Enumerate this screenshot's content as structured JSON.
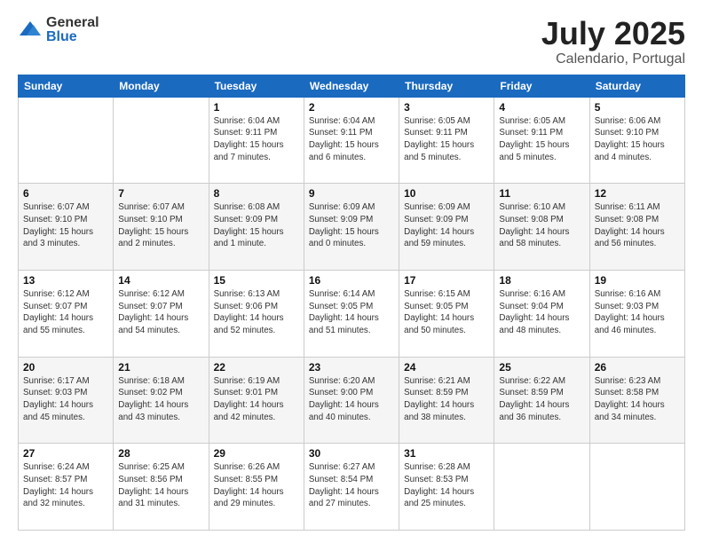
{
  "logo": {
    "general": "General",
    "blue": "Blue"
  },
  "title": "July 2025",
  "subtitle": "Calendario, Portugal",
  "header_days": [
    "Sunday",
    "Monday",
    "Tuesday",
    "Wednesday",
    "Thursday",
    "Friday",
    "Saturday"
  ],
  "weeks": [
    [
      {
        "day": "",
        "detail": ""
      },
      {
        "day": "",
        "detail": ""
      },
      {
        "day": "1",
        "detail": "Sunrise: 6:04 AM\nSunset: 9:11 PM\nDaylight: 15 hours\nand 7 minutes."
      },
      {
        "day": "2",
        "detail": "Sunrise: 6:04 AM\nSunset: 9:11 PM\nDaylight: 15 hours\nand 6 minutes."
      },
      {
        "day": "3",
        "detail": "Sunrise: 6:05 AM\nSunset: 9:11 PM\nDaylight: 15 hours\nand 5 minutes."
      },
      {
        "day": "4",
        "detail": "Sunrise: 6:05 AM\nSunset: 9:11 PM\nDaylight: 15 hours\nand 5 minutes."
      },
      {
        "day": "5",
        "detail": "Sunrise: 6:06 AM\nSunset: 9:10 PM\nDaylight: 15 hours\nand 4 minutes."
      }
    ],
    [
      {
        "day": "6",
        "detail": "Sunrise: 6:07 AM\nSunset: 9:10 PM\nDaylight: 15 hours\nand 3 minutes."
      },
      {
        "day": "7",
        "detail": "Sunrise: 6:07 AM\nSunset: 9:10 PM\nDaylight: 15 hours\nand 2 minutes."
      },
      {
        "day": "8",
        "detail": "Sunrise: 6:08 AM\nSunset: 9:09 PM\nDaylight: 15 hours\nand 1 minute."
      },
      {
        "day": "9",
        "detail": "Sunrise: 6:09 AM\nSunset: 9:09 PM\nDaylight: 15 hours\nand 0 minutes."
      },
      {
        "day": "10",
        "detail": "Sunrise: 6:09 AM\nSunset: 9:09 PM\nDaylight: 14 hours\nand 59 minutes."
      },
      {
        "day": "11",
        "detail": "Sunrise: 6:10 AM\nSunset: 9:08 PM\nDaylight: 14 hours\nand 58 minutes."
      },
      {
        "day": "12",
        "detail": "Sunrise: 6:11 AM\nSunset: 9:08 PM\nDaylight: 14 hours\nand 56 minutes."
      }
    ],
    [
      {
        "day": "13",
        "detail": "Sunrise: 6:12 AM\nSunset: 9:07 PM\nDaylight: 14 hours\nand 55 minutes."
      },
      {
        "day": "14",
        "detail": "Sunrise: 6:12 AM\nSunset: 9:07 PM\nDaylight: 14 hours\nand 54 minutes."
      },
      {
        "day": "15",
        "detail": "Sunrise: 6:13 AM\nSunset: 9:06 PM\nDaylight: 14 hours\nand 52 minutes."
      },
      {
        "day": "16",
        "detail": "Sunrise: 6:14 AM\nSunset: 9:05 PM\nDaylight: 14 hours\nand 51 minutes."
      },
      {
        "day": "17",
        "detail": "Sunrise: 6:15 AM\nSunset: 9:05 PM\nDaylight: 14 hours\nand 50 minutes."
      },
      {
        "day": "18",
        "detail": "Sunrise: 6:16 AM\nSunset: 9:04 PM\nDaylight: 14 hours\nand 48 minutes."
      },
      {
        "day": "19",
        "detail": "Sunrise: 6:16 AM\nSunset: 9:03 PM\nDaylight: 14 hours\nand 46 minutes."
      }
    ],
    [
      {
        "day": "20",
        "detail": "Sunrise: 6:17 AM\nSunset: 9:03 PM\nDaylight: 14 hours\nand 45 minutes."
      },
      {
        "day": "21",
        "detail": "Sunrise: 6:18 AM\nSunset: 9:02 PM\nDaylight: 14 hours\nand 43 minutes."
      },
      {
        "day": "22",
        "detail": "Sunrise: 6:19 AM\nSunset: 9:01 PM\nDaylight: 14 hours\nand 42 minutes."
      },
      {
        "day": "23",
        "detail": "Sunrise: 6:20 AM\nSunset: 9:00 PM\nDaylight: 14 hours\nand 40 minutes."
      },
      {
        "day": "24",
        "detail": "Sunrise: 6:21 AM\nSunset: 8:59 PM\nDaylight: 14 hours\nand 38 minutes."
      },
      {
        "day": "25",
        "detail": "Sunrise: 6:22 AM\nSunset: 8:59 PM\nDaylight: 14 hours\nand 36 minutes."
      },
      {
        "day": "26",
        "detail": "Sunrise: 6:23 AM\nSunset: 8:58 PM\nDaylight: 14 hours\nand 34 minutes."
      }
    ],
    [
      {
        "day": "27",
        "detail": "Sunrise: 6:24 AM\nSunset: 8:57 PM\nDaylight: 14 hours\nand 32 minutes."
      },
      {
        "day": "28",
        "detail": "Sunrise: 6:25 AM\nSunset: 8:56 PM\nDaylight: 14 hours\nand 31 minutes."
      },
      {
        "day": "29",
        "detail": "Sunrise: 6:26 AM\nSunset: 8:55 PM\nDaylight: 14 hours\nand 29 minutes."
      },
      {
        "day": "30",
        "detail": "Sunrise: 6:27 AM\nSunset: 8:54 PM\nDaylight: 14 hours\nand 27 minutes."
      },
      {
        "day": "31",
        "detail": "Sunrise: 6:28 AM\nSunset: 8:53 PM\nDaylight: 14 hours\nand 25 minutes."
      },
      {
        "day": "",
        "detail": ""
      },
      {
        "day": "",
        "detail": ""
      }
    ]
  ]
}
